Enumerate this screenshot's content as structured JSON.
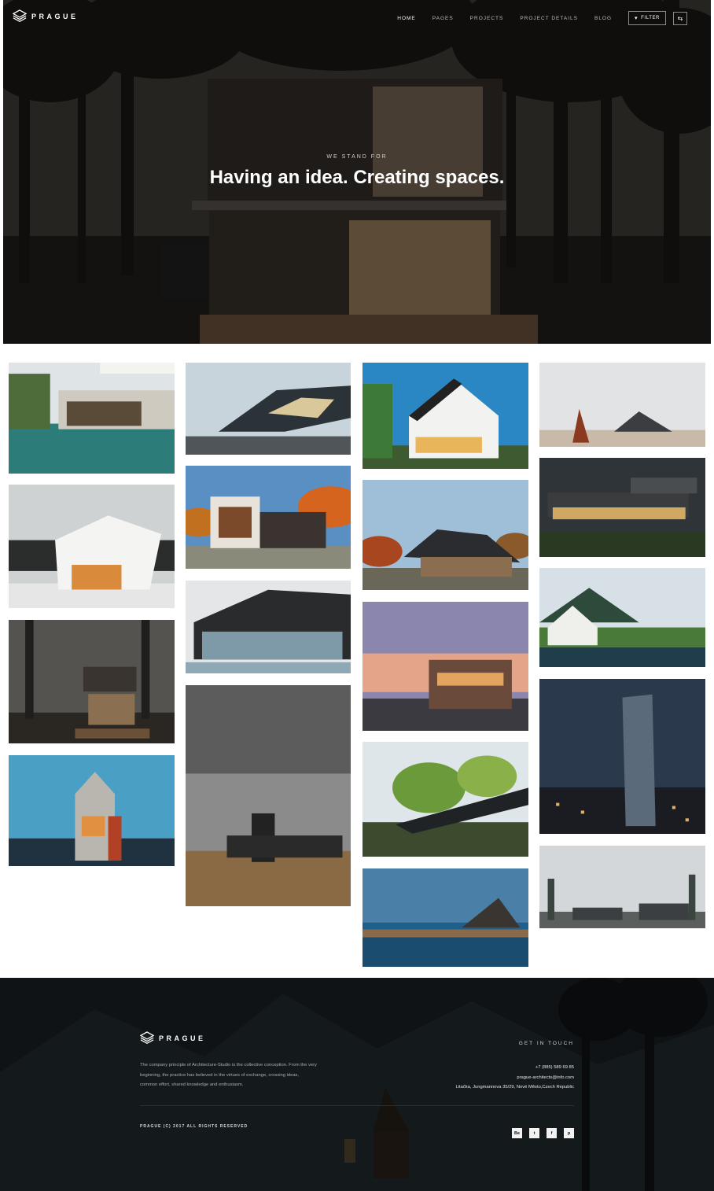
{
  "brand": {
    "name": "PRAGUE"
  },
  "nav": {
    "items": [
      {
        "label": "HOME",
        "active": true
      },
      {
        "label": "PAGES",
        "active": false
      },
      {
        "label": "PROJECTS",
        "active": false
      },
      {
        "label": "PROJECT DETAILS",
        "active": false
      },
      {
        "label": "BLOG",
        "active": false
      }
    ],
    "filter_label": "FILTER",
    "filter_icon": "filter-icon",
    "share_icon": "share-icon"
  },
  "hero": {
    "subtitle": "WE STAND FOR",
    "title": "Having an idea. Creating spaces."
  },
  "gallery": {
    "images": [
      "pool-villa-photo",
      "folded-roof-house-photo",
      "forest-cabin-photo",
      "tower-house-photo",
      "futuristic-pavilion-photo",
      "autumn-modern-house-photo",
      "black-glass-house-photo",
      "monochrome-field-house-photo",
      "white-gable-house-photo",
      "pitched-roof-lodge-photo",
      "sunset-townhouses-photo",
      "forest-bridge-house-photo",
      "lake-landscape-photo",
      "pyramid-pavilion-photo",
      "cantilever-house-photo",
      "mountain-cabin-photo",
      "city-skyscraper-photo",
      "misty-forest-houses-photo"
    ]
  },
  "footer": {
    "description": "The company principle of Architecture-Studio is the collective conception. From the very beginning, the practice has believed in the virtues of exchange, crossing ideas, common effort, shared knowledge and enthusiasm.",
    "contact_heading": "GET IN TOUCH",
    "phone": "+7 (885) 589 69 85",
    "email": "prague-architects@info.com",
    "address": "Litačka, Jungmannova 35/29, Nové Město,Czech Republic",
    "copyright": "PRAGUE (C) 2017 ALL RIGHTS RESERVED",
    "socials": [
      {
        "label": "Be",
        "icon": "behance-icon"
      },
      {
        "label": "t",
        "icon": "twitter-icon"
      },
      {
        "label": "f",
        "icon": "facebook-icon"
      },
      {
        "label": "p",
        "icon": "pinterest-icon"
      }
    ]
  }
}
